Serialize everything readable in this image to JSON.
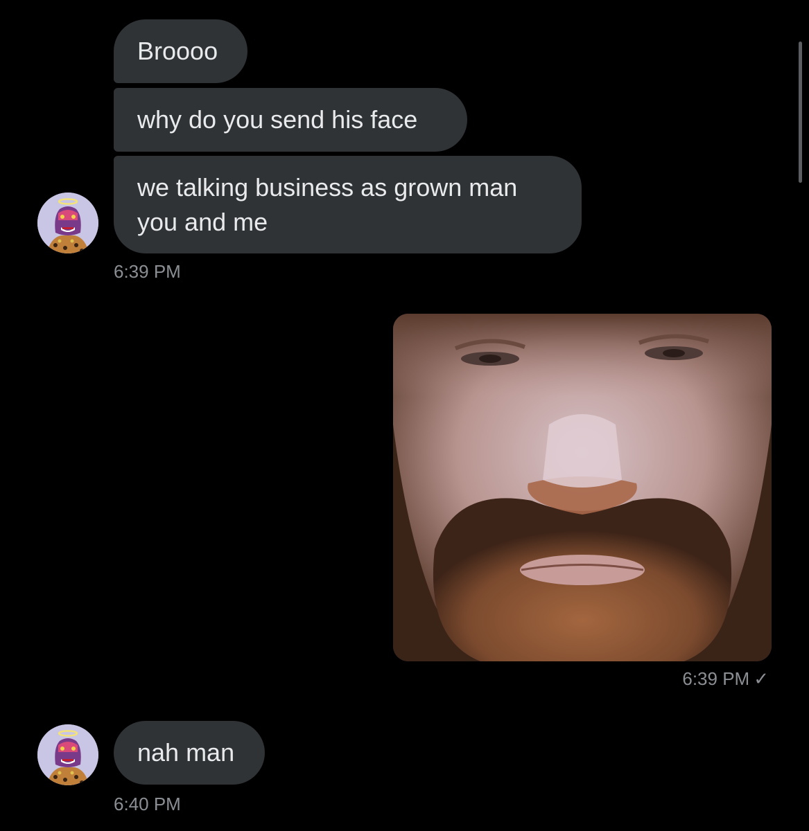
{
  "messages": {
    "m1": "Broooo",
    "m2": "why do you send his face",
    "m3": "we talking business as grown man you and me",
    "m4": "nah man"
  },
  "timestamps": {
    "t1": "6:39 PM",
    "t2": "6:39 PM",
    "t3": "6:40 PM"
  },
  "icons": {
    "sent_check": "✓",
    "avatar": "ape-avatar-icon"
  },
  "colors": {
    "background": "#000000",
    "bubble": "#2f3336",
    "text": "#e9eaec",
    "timestamp": "#8b8f94"
  }
}
